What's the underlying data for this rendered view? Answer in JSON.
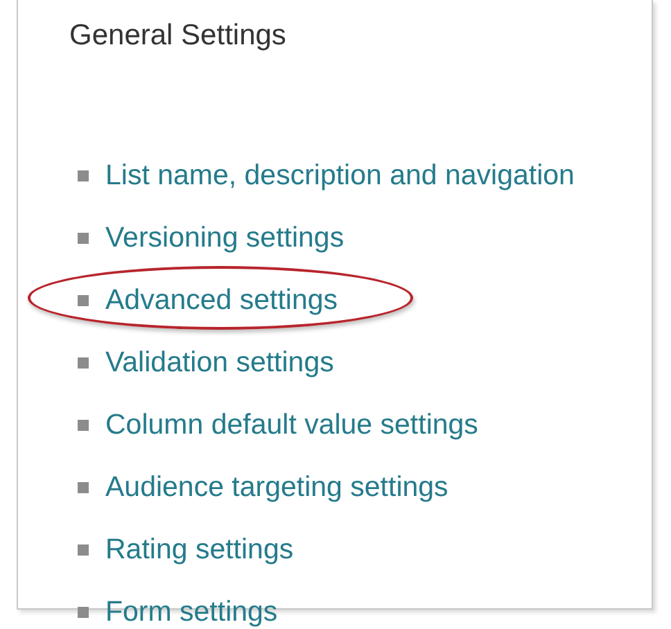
{
  "heading": "General Settings",
  "items": [
    {
      "label": "List name, description and navigation",
      "circled": false
    },
    {
      "label": "Versioning settings",
      "circled": false
    },
    {
      "label": "Advanced settings",
      "circled": true
    },
    {
      "label": "Validation settings",
      "circled": false
    },
    {
      "label": "Column default value settings",
      "circled": false
    },
    {
      "label": "Audience targeting settings",
      "circled": false
    },
    {
      "label": "Rating settings",
      "circled": false
    },
    {
      "label": "Form settings",
      "circled": false
    }
  ]
}
